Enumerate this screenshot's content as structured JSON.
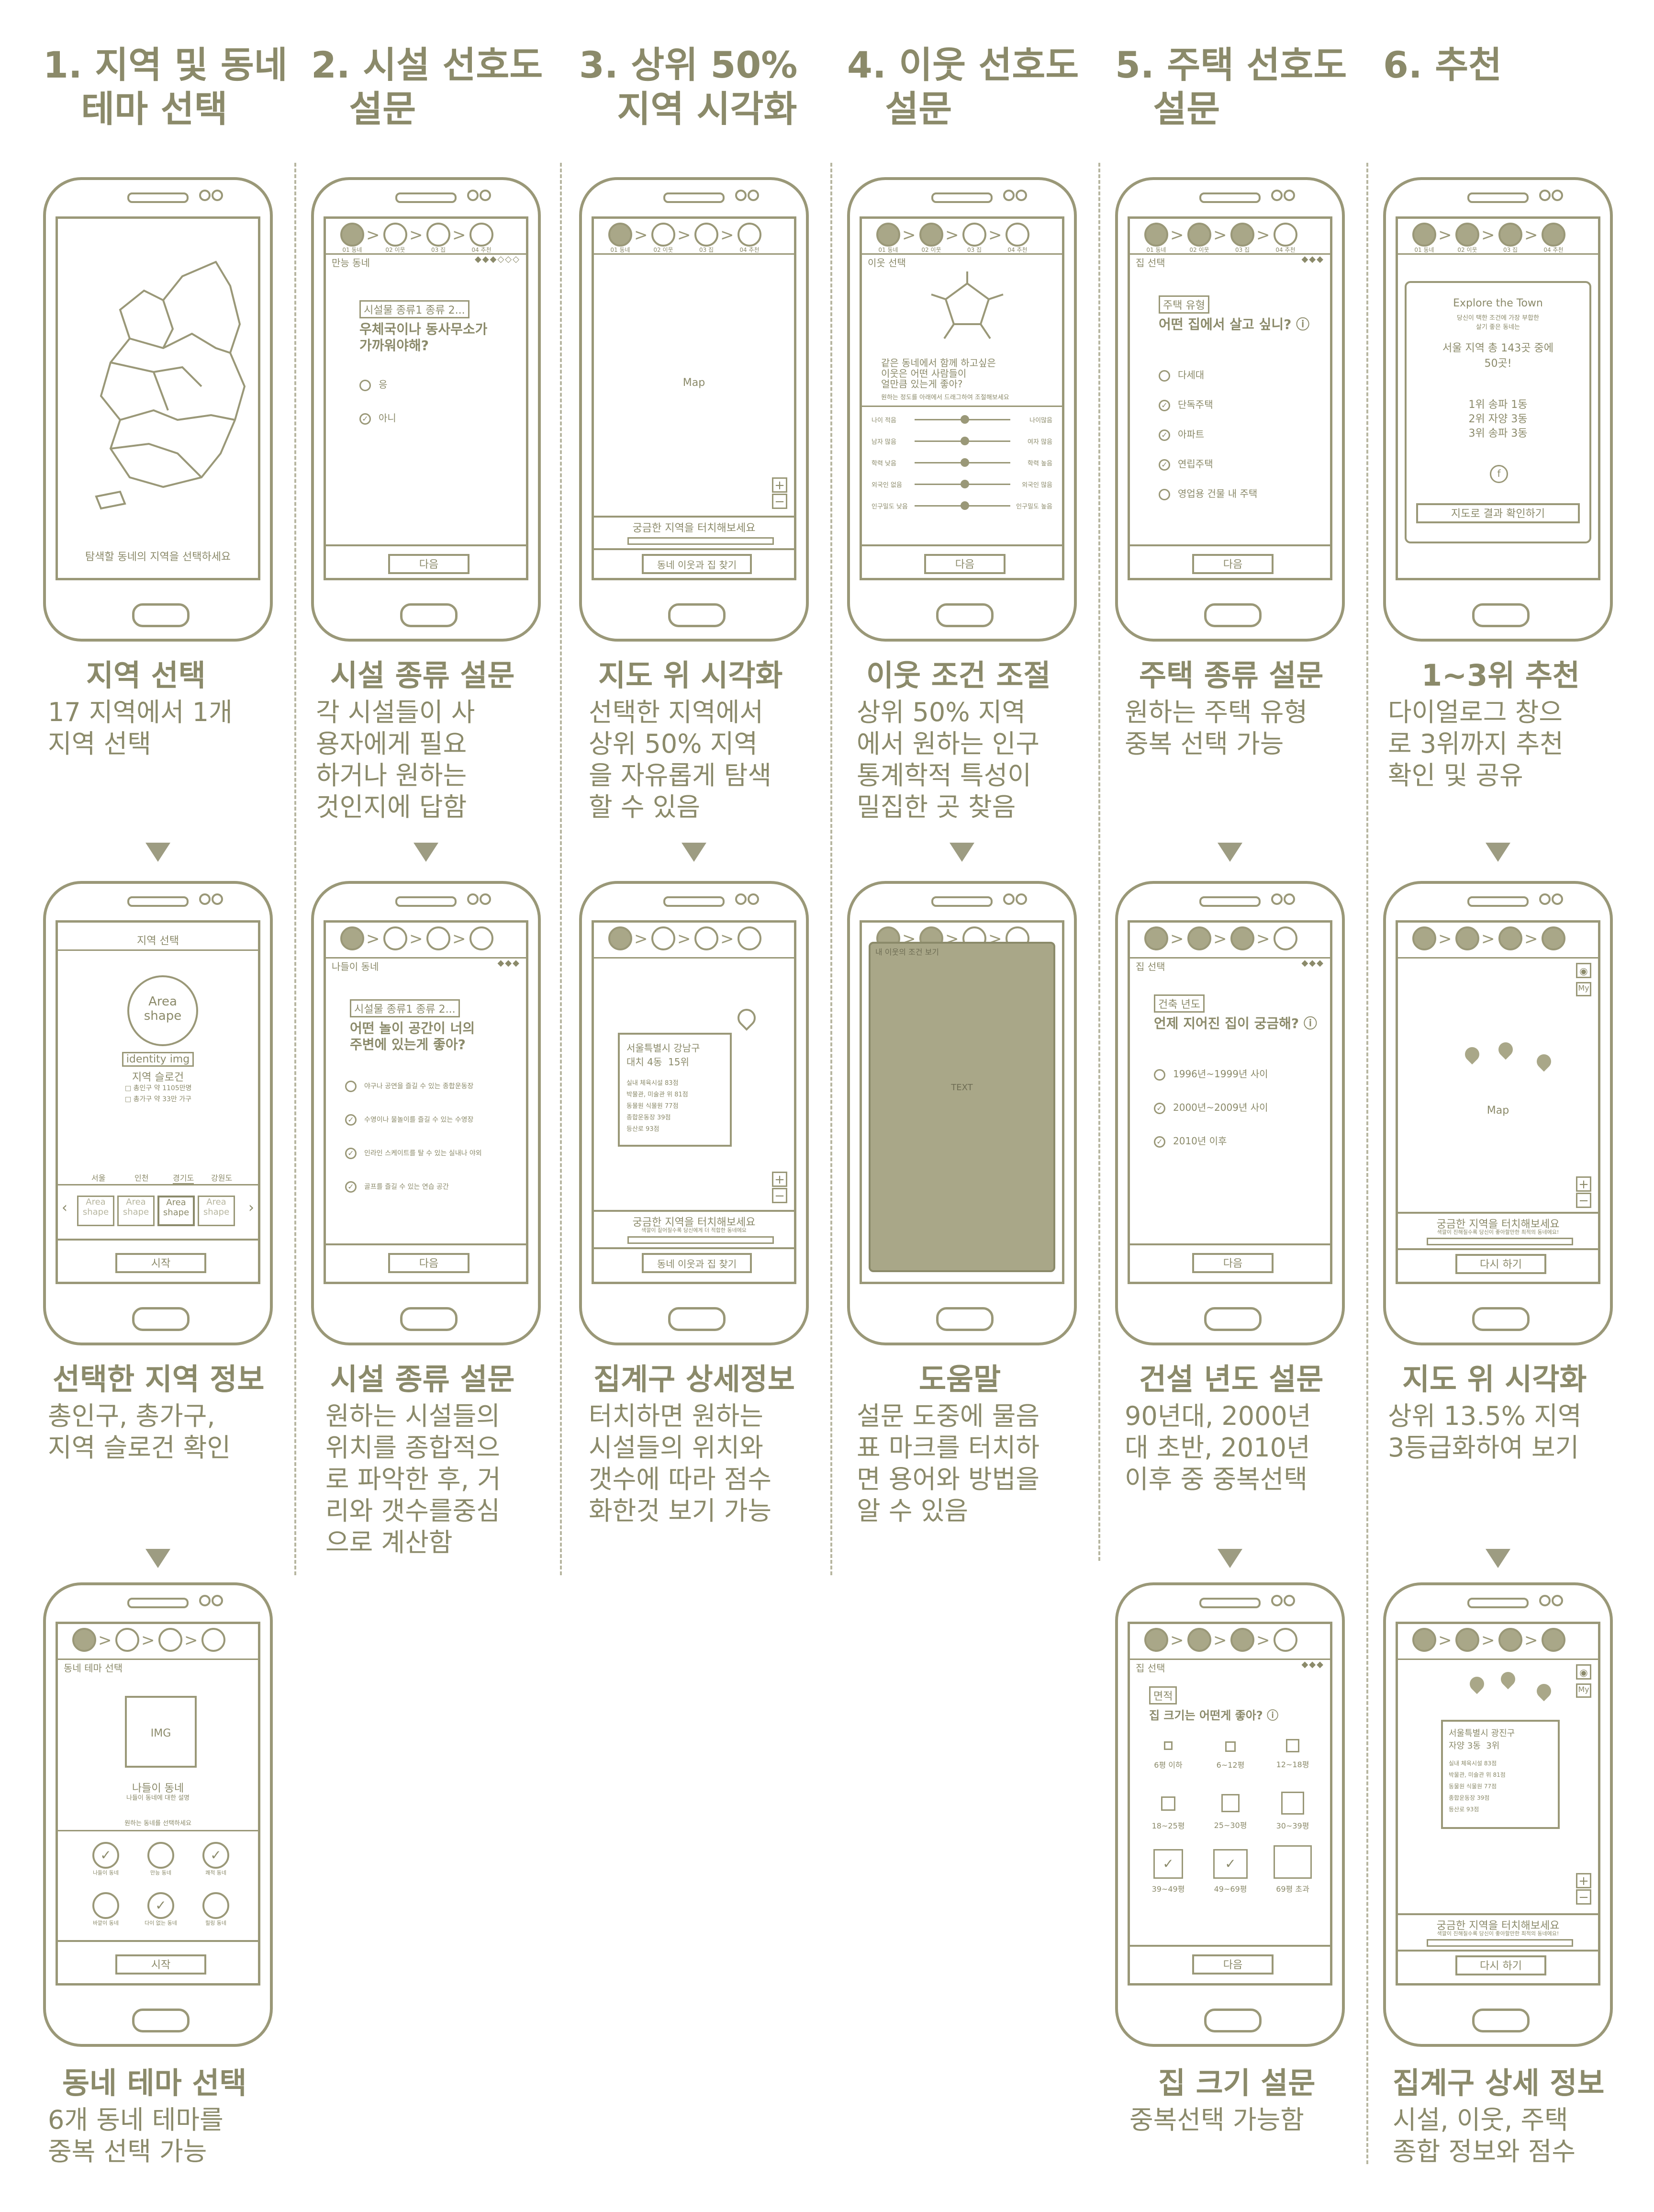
{
  "columns": [
    {
      "header": "1. 지역 및 동네\n   테마 선택"
    },
    {
      "header": "2. 시설 선호도\n   설문"
    },
    {
      "header": "3. 상위 50%\n   지역 시각화"
    },
    {
      "header": "4. 이웃 선호도\n   설문"
    },
    {
      "header": "5. 주택 선호도\n   설문"
    },
    {
      "header": "6. 추천"
    }
  ],
  "steps": [
    "01 동네",
    "02 이웃",
    "03 집",
    "04 추천"
  ],
  "captions": {
    "c1r1": {
      "title": "지역 선택",
      "body": "17 지역에서 1개\n지역 선택"
    },
    "c2r1": {
      "title": "시설 종류 설문",
      "body": "각 시설들이 사\n용자에게 필요\n하거나 원하는\n것인지에 답함"
    },
    "c3r1": {
      "title": "지도 위 시각화",
      "body": "선택한 지역에서\n상위 50% 지역\n을 자유롭게 탐색\n할 수 있음"
    },
    "c4r1": {
      "title": "이웃 조건 조절",
      "body": "상위 50% 지역\n에서 원하는 인구\n통계학적 특성이\n밀집한 곳 찾음"
    },
    "c5r1": {
      "title": "주택 종류 설문",
      "body": "원하는 주택 유형\n중복 선택 가능"
    },
    "c6r1": {
      "title": "1~3위 추천",
      "body": "다이얼로그 창으\n로 3위까지 추천\n확인 및 공유"
    },
    "c1r2": {
      "title": "선택한 지역 정보",
      "body": "총인구, 총가구,\n지역 슬로건 확인"
    },
    "c2r2": {
      "title": "시설 종류 설문",
      "body": "원하는 시설들의\n위치를 종합적으\n로 파악한 후, 거\n리와 갯수를중심\n으로 계산함"
    },
    "c3r2": {
      "title": "집계구 상세정보",
      "body": "터치하면 원하는\n시설들의 위치와\n갯수에 따라 점수\n화한것 보기 가능"
    },
    "c4r2": {
      "title": "도움말",
      "body": "설문 도중에 물음\n표 마크를 터치하\n면 용어와 방법을\n알 수 있음"
    },
    "c5r2": {
      "title": "건설 년도 설문",
      "body": "90년대, 2000년\n대 초반, 2010년\n이후 중 중복선택"
    },
    "c6r2": {
      "title": "지도 위 시각화",
      "body": "상위 13.5% 지역\n3등급화하여 보기"
    },
    "c1r3": {
      "title": "동네 테마 선택",
      "body": "6개 동네 테마를\n중복 선택 가능"
    },
    "c5r3": {
      "title": "집 크기 설문",
      "body": "중복선택 가능함"
    },
    "c6r3": {
      "title": "집계구 상세 정보",
      "body": "시설, 이웃, 주택\n종합 정보와 점수"
    }
  },
  "screens": {
    "s11": {
      "hint": "탐색할 동네의 지역을 선택하세요"
    },
    "s21": {
      "title": "만능 동네",
      "tag": "시설물 종류1  종류 2...",
      "question": "우체국이나 동사무소가\n가까워야해?",
      "opt1": "응",
      "opt2": "아니",
      "next": "다음"
    },
    "s31": {
      "map": "Map",
      "hint": "궁금한 지역을 터치해보세요",
      "button": "동네 이웃과 집 찾기"
    },
    "s41": {
      "title": "이웃 선택",
      "question": "같은 동네에서 함께 하고싶은\n이웃은 어떤 사람들이\n얼만큼 있는게 좋아?",
      "sub": "원하는 정도를 아래에서 드래그하여 조절해보세요",
      "sliders": [
        [
          "나이 적음",
          "나이많음"
        ],
        [
          "남자 많음",
          "여자 많음"
        ],
        [
          "학력 낮음",
          "학력 높음"
        ],
        [
          "외국인 없음",
          "외국인 많음"
        ],
        [
          "인구밀도 낮음",
          "인구밀도 높음"
        ]
      ],
      "next": "다음"
    },
    "s51": {
      "title": "집 선택",
      "tag": "주택 유형",
      "question": "어떤 집에서 살고 싶니?",
      "options": [
        "다세대",
        "단독주택",
        "아파트",
        "연립주택",
        "영업용 건물 내 주택"
      ],
      "next": "다음"
    },
    "s61": {
      "dlg_title": "Explore the Town",
      "dlg_sub": "당신이 택한 조건에 가장 부합한\n살기 좋은 동네는",
      "dlg_result": "서울 지역 총 143곳 중에\n50곳!",
      "ranks": [
        "1위  송파  1동",
        "2위  자양  3동",
        "3위  송파  3동"
      ],
      "button": "지도로 결과 확인하기"
    },
    "s12": {
      "title": "지역 선택",
      "area": "Area\nshape",
      "identity": "identity img",
      "slogan": "지역 슬로건",
      "pop": "□ 총인구  약 1105만명",
      "house": "□ 총가구  약 33만 가구",
      "tabs": [
        "서울",
        "인천",
        "경기도",
        "강원도"
      ],
      "shape": "Area\nshape",
      "start": "시작"
    },
    "s22": {
      "title": "나들이 동네",
      "tag": "시설물 종류1  종류 2...",
      "question": "어떤 놀이 공간이 너의\n주변에 있는게 좋아?",
      "options": [
        "야구나 공연을 즐길 수 있는 종합운동장",
        "수영이나 물놀이를 즐길 수 있는 수영장",
        "인라인 스케이트를 탈 수 있는 실내나 야외",
        "골프를 즐길 수 있는 연습 공간"
      ],
      "next": "다음"
    },
    "s32": {
      "info_title": "서울특별시 강남구\n대치 4동  15위",
      "info_lines": [
        "실내 체육시설 83점",
        "박물관, 미술관 위 81점",
        "동물원 식물원 77점",
        "종합운동장 39점",
        "등산로 93점"
      ],
      "hint": "궁금한 지역을 터치해보세요",
      "sub": "색깔이 짙어질수록 당신에게 더 적합한 동네에요",
      "button": "동네 이웃과 집 찾기"
    },
    "s42": {
      "title": "내 이웃의 조건 보기",
      "text": "TEXT"
    },
    "s52": {
      "title": "집 선택",
      "tag": "건축 년도",
      "question": "언제 지어진 집이 궁금해?",
      "options": [
        "1996년~1999년 사이",
        "2000년~2009년 사이",
        "2010년 이후"
      ],
      "next": "다음"
    },
    "s62": {
      "map": "Map",
      "my": "My",
      "hint": "궁금한 지역을 터치해보세요",
      "sub": "색깔이 진해질수록 당신이 좋아할만한 최적의 동네에요!",
      "button": "다시 하기"
    },
    "s13": {
      "title": "동네 테마 선택",
      "img": "IMG",
      "name": "나들이 동네",
      "desc": "나들이 동네에 대한 설명",
      "prompt": "원하는 동네를 선택하세요",
      "themes": [
        "나들이 동네",
        "만능 동네",
        "쾌적 동네",
        "바깥이 동네",
        "다이 없는 동네",
        "힐링 동네"
      ],
      "start": "시작"
    },
    "s53": {
      "title": "집 선택",
      "tag": "면적",
      "question": "집 크기는 어떤게 좋아?",
      "sizes": [
        "6평 이하",
        "6~12평",
        "12~18평",
        "18~25평",
        "25~30평",
        "30~39평",
        "39~49평",
        "49~69평",
        "69평 초과"
      ],
      "next": "다음"
    },
    "s63": {
      "my": "My",
      "info_title": "서울특별시 광진구\n자양 3동  3위",
      "info_lines": [
        "실내 체육시설 83점",
        "박물관, 미술관 위 81점",
        "동물원 식물원 77점",
        "종합운동장 39점",
        "등산로 93점"
      ],
      "hint": "궁금한 지역을 터치해보세요",
      "sub": "색깔이 진해질수록 당신이 좋아할만한 최적의 동네에요!",
      "button": "다시 하기"
    }
  }
}
